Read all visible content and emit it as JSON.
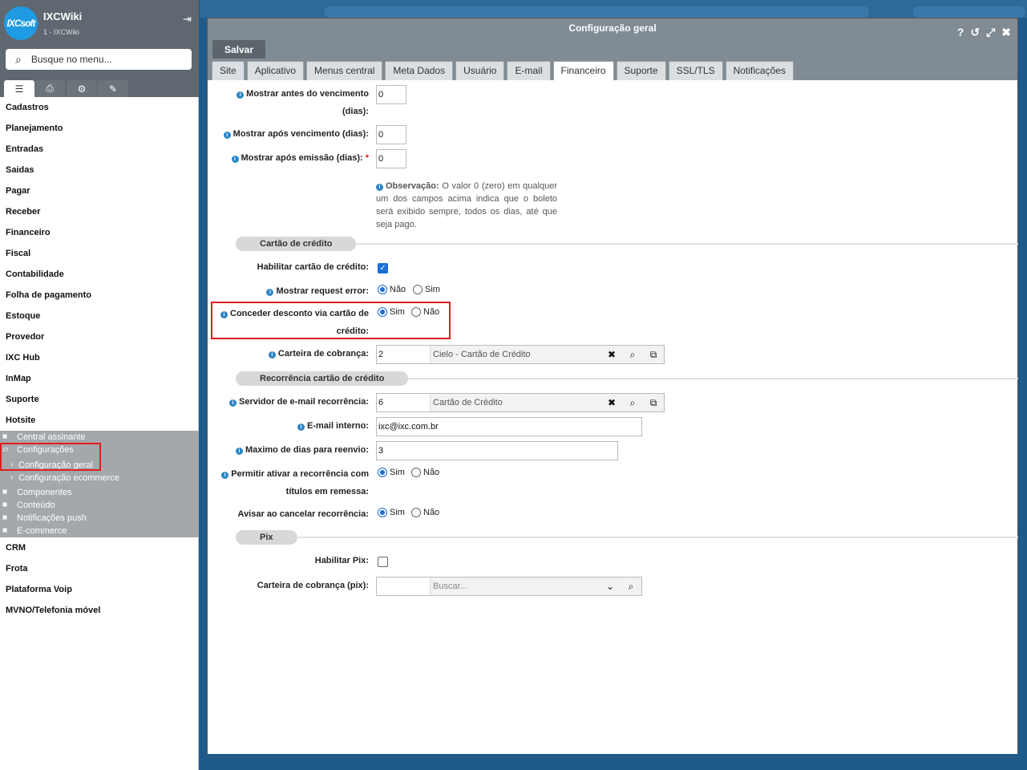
{
  "app": {
    "logo_text": "IXCsoft",
    "title": "IXCWiki",
    "subtitle": "1 - IXCWiki"
  },
  "sidebar": {
    "search_placeholder": "Busque no menu...",
    "tabs": [
      {
        "icon": "list-icon"
      },
      {
        "icon": "print-icon"
      },
      {
        "icon": "gears-icon"
      },
      {
        "icon": "wrench-icon"
      }
    ],
    "menu_items": [
      "Cadastros",
      "Planejamento",
      "Entradas",
      "Saidas",
      "Pagar",
      "Receber",
      "Financeiro",
      "Fiscal",
      "Contabilidade",
      "Folha de pagamento",
      "Estoque",
      "Provedor",
      "IXC Hub",
      "InMap",
      "Suporte",
      "Hotsite"
    ],
    "submenu": [
      {
        "label": "Central assinante",
        "type": "folder"
      },
      {
        "label": "Configurações",
        "type": "folder-open"
      },
      {
        "label": "Configuração geral",
        "type": "sub"
      },
      {
        "label": "Configuração ecommerce",
        "type": "sub"
      },
      {
        "label": "Componentes",
        "type": "folder"
      },
      {
        "label": "Conteúdo",
        "type": "folder"
      },
      {
        "label": "Notificações push",
        "type": "folder"
      },
      {
        "label": "E-commerce",
        "type": "folder"
      }
    ],
    "menu_items_after": [
      "CRM",
      "Frota",
      "Plataforma Voip",
      "MVNO/Telefonia móvel"
    ]
  },
  "window": {
    "title": "Configuração geral",
    "save_label": "Salvar",
    "tabs": [
      "Site",
      "Aplicativo",
      "Menus central",
      "Meta Dados",
      "Usuário",
      "E-mail",
      "Financeiro",
      "Suporte",
      "SSL/TLS",
      "Notificações"
    ],
    "active_tab": "Financeiro"
  },
  "form": {
    "antes_vencimento": {
      "label_1": "Mostrar antes do vencimento",
      "label_2": "(dias):",
      "value": "0"
    },
    "apos_vencimento": {
      "label": "Mostrar após vencimento (dias):",
      "value": "0"
    },
    "apos_emissao": {
      "label": "Mostrar após emissão (dias):",
      "required": "*",
      "value": "0"
    },
    "observacao": {
      "title": "Observação:",
      "text": "O valor 0 (zero) em qualquer um dos campos acima indica que o boleto será exibido sempre, todos os dias, até que seja pago."
    },
    "cartao_section": "Cartão de crédito",
    "habilitar_cartao": {
      "label": "Habilitar cartão de crédito:",
      "checked": true
    },
    "request_error": {
      "label": "Mostrar request error:",
      "opt1": "Não",
      "opt2": "Sim",
      "selected": "Não"
    },
    "desconto_cartao": {
      "label_1": "Conceder desconto via cartão de",
      "label_2": "crédito:",
      "opt1": "Sim",
      "opt2": "Não",
      "selected": "Sim"
    },
    "carteira_cobranca": {
      "label": "Carteira de cobrança:",
      "code": "2",
      "desc": "Cielo - Cartão de Crédito"
    },
    "recorrencia_section": "Recorrência cartão de crédito",
    "servidor_email": {
      "label": "Servidor de e-mail recorrência:",
      "code": "6",
      "desc": "Cartão de Crédito"
    },
    "email_interno": {
      "label": "E-mail interno:",
      "value": "ixc@ixc.com.br"
    },
    "max_dias": {
      "label": "Maximo de dias para reenvio:",
      "value": "3"
    },
    "permitir_recorrencia": {
      "label_1": "Permitir ativar a recorrência com",
      "label_2": "títulos em remessa:",
      "opt1": "Sim",
      "opt2": "Não",
      "selected": "Sim"
    },
    "avisar_cancelar": {
      "label": "Avisar ao cancelar recorrência:",
      "opt1": "Sim",
      "opt2": "Não",
      "selected": "Sim"
    },
    "pix_section": "Pix",
    "habilitar_pix": {
      "label": "Habilitar Pix:",
      "checked": false
    },
    "carteira_pix": {
      "label": "Carteira de cobrança (pix):",
      "placeholder": "Buscar..."
    }
  },
  "colors": {
    "accent": "#1a6fd8",
    "header": "#808b93",
    "highlight": "#e01e1e"
  }
}
